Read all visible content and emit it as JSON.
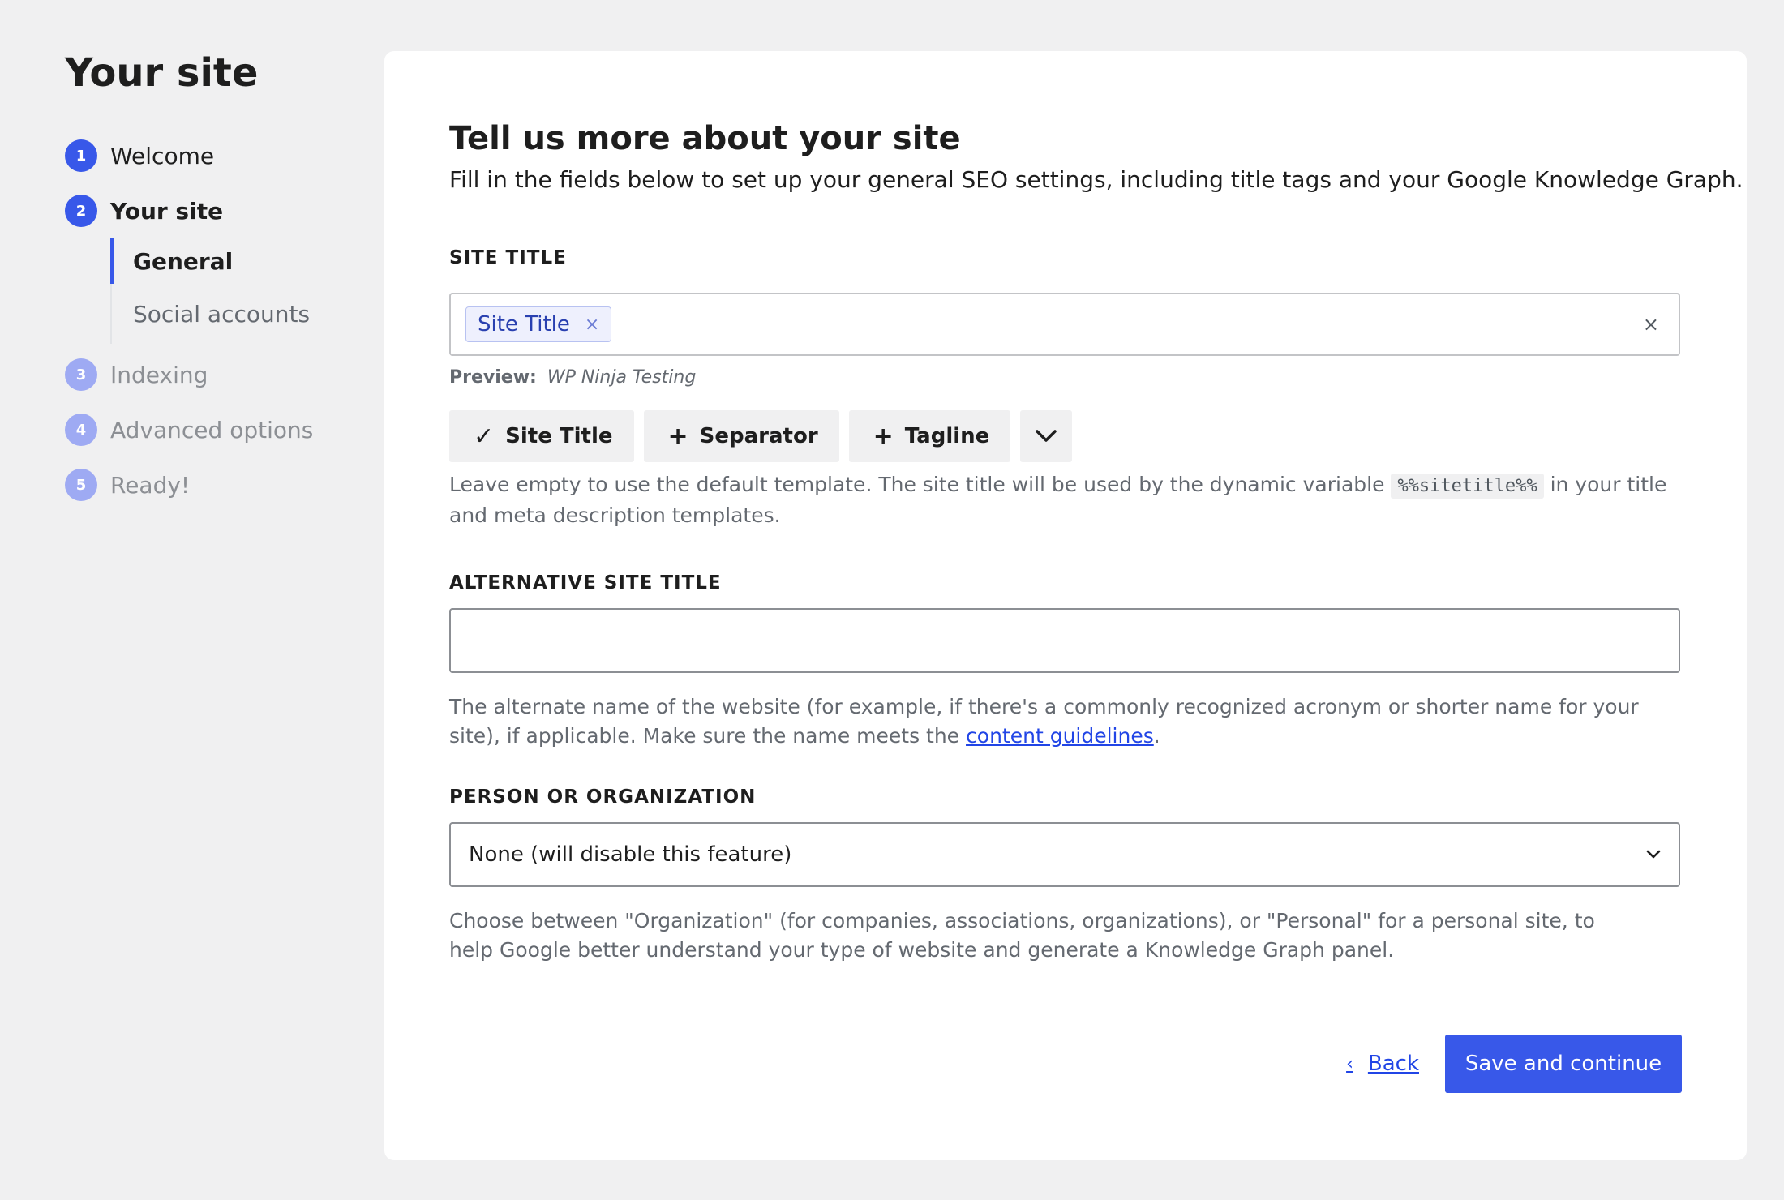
{
  "sidebar": {
    "title": "Your site",
    "steps": [
      {
        "number": "1",
        "label": "Welcome"
      },
      {
        "number": "2",
        "label": "Your site"
      },
      {
        "number": "3",
        "label": "Indexing"
      },
      {
        "number": "4",
        "label": "Advanced options"
      },
      {
        "number": "5",
        "label": "Ready!"
      }
    ],
    "substeps": [
      {
        "label": "General"
      },
      {
        "label": "Social accounts"
      }
    ]
  },
  "main": {
    "heading": "Tell us more about your site",
    "subheading": "Fill in the fields below to set up your general SEO settings, including title tags and your Google Knowledge Graph.",
    "site_title": {
      "label": "SITE TITLE",
      "chip": "Site Title",
      "chip_remove": "×",
      "clear": "×",
      "preview_label": "Preview:",
      "preview_value": "WP Ninja Testing",
      "buttons": [
        {
          "icon": "✓",
          "label": "Site Title"
        },
        {
          "icon": "+",
          "label": "Separator"
        },
        {
          "icon": "+",
          "label": "Tagline"
        }
      ],
      "help_before": "Leave empty to use the default template. The site title will be used by the dynamic variable",
      "help_code": "%%sitetitle%%",
      "help_after": "in your title and meta description templates."
    },
    "alt_title": {
      "label": "ALTERNATIVE SITE TITLE",
      "value": "",
      "help_before": "The alternate name of the website (for example, if there's a commonly recognized acronym or shorter name for your site), if applicable. Make sure the name meets the",
      "help_link": "content guidelines",
      "help_after": "."
    },
    "person_org": {
      "label": "PERSON OR ORGANIZATION",
      "selected": "None (will disable this feature)",
      "help": "Choose between \"Organization\" (for companies, associations, organizations), or \"Personal\" for a personal site, to help Google better understand your type of website and generate a Knowledge Graph panel."
    },
    "footer": {
      "back_icon": "‹",
      "back_label": "Back",
      "save_label": "Save and continue"
    }
  },
  "colors": {
    "accent": "#3858e9",
    "accent_pending": "#9eaaf3",
    "link": "#2145e6",
    "background": "#f0f0f1"
  }
}
